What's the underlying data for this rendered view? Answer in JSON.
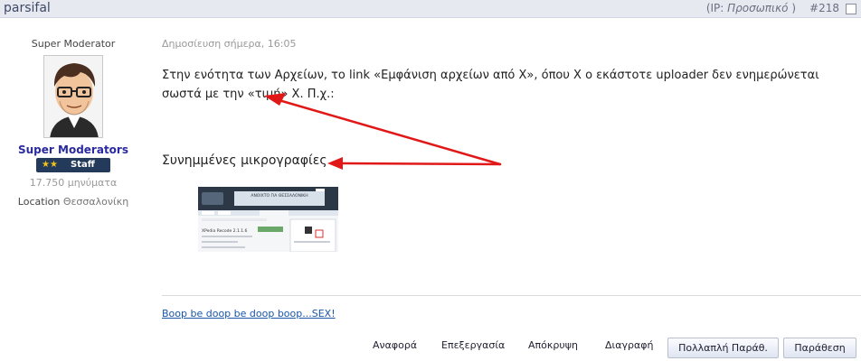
{
  "header": {
    "username": "parsifal",
    "ip_prefix": "(IP: ",
    "ip_value": "Προσωπικό",
    "ip_suffix": " )",
    "post_number": "#218"
  },
  "userinfo": {
    "title": "Super Moderator",
    "group": "Super Moderators",
    "rank_label": "Staff",
    "post_count": "17.750 μηνύματα",
    "location_label": "Location",
    "location_value": "Θεσσαλονίκη"
  },
  "post": {
    "date": "Δημοσίευση σήμερα, 16:05",
    "text": "Στην ενότητα των Αρχείων, το link «Εμφάνιση αρχείων από X», όπου X ο εκάστοτε uploader δεν ενημερώνεται σωστά με την «τιμή» Χ. Π.χ.:",
    "attachments_title": "Συνημμένες μικρογραφίες",
    "thumbnail": {
      "banner": "ΑΝΟΙΧΤΟ ΓΙΑ ΘΕΣΣΑΛΟΝΙΚΗ",
      "entry_title": "XPedia Recode 2.1.1.6"
    },
    "signature": "Boop be doop be doop boop...SEX!"
  },
  "actions": {
    "report": "Αναφορά",
    "edit": "Επεξεργασία",
    "hide": "Απόκρυψη",
    "delete": "Διαγραφή",
    "multiquote": "Πολλαπλή Παράθ.",
    "quote": "Παράθεση"
  },
  "colors": {
    "header_bg": "#e7e9f1",
    "group": "#2a2aa0",
    "link": "#1a55a8",
    "arrow": "#e01818"
  }
}
